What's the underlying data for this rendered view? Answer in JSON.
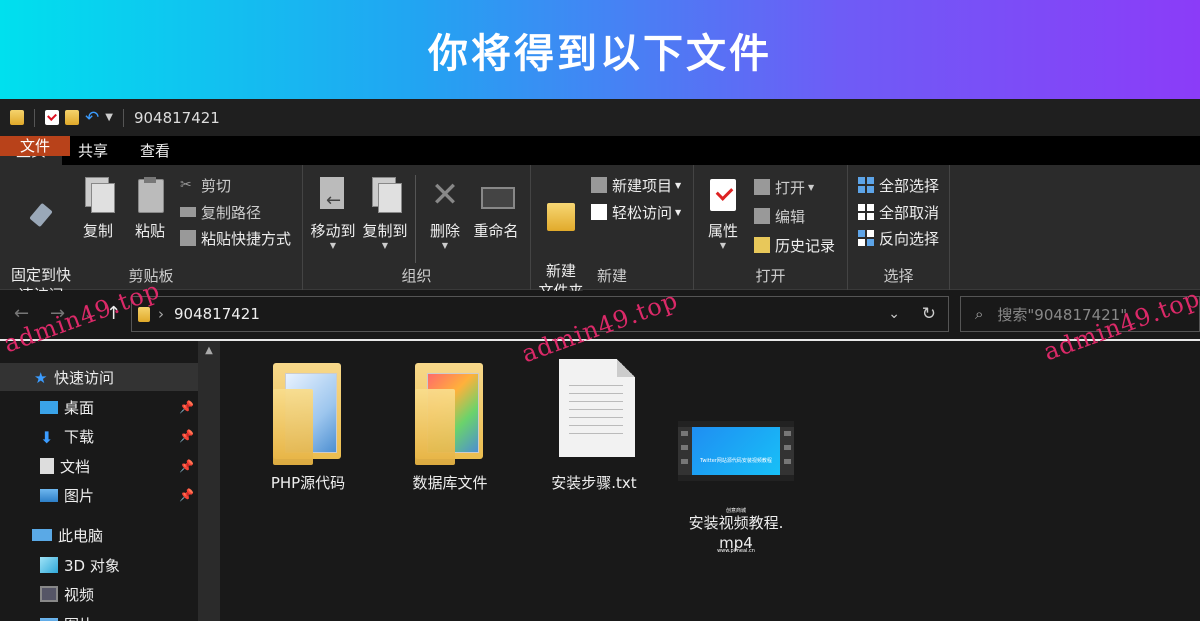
{
  "banner": {
    "title": "你将得到以下文件"
  },
  "titlebar": {
    "path_label": "904817421"
  },
  "tabs": [
    {
      "label": "文件"
    },
    {
      "label": "主页"
    },
    {
      "label": "共享"
    },
    {
      "label": "查看"
    }
  ],
  "ribbon": {
    "clipboard": {
      "pin_label": "固定到快\n速访问",
      "copy_label": "复制",
      "paste_label": "粘贴",
      "cut_label": "剪切",
      "copy_path_label": "复制路径",
      "paste_shortcut_label": "粘贴快捷方式",
      "group_label": "剪贴板"
    },
    "organize": {
      "move_to_label": "移动到",
      "copy_to_label": "复制到",
      "delete_label": "删除",
      "rename_label": "重命名",
      "group_label": "组织"
    },
    "new": {
      "new_folder_label": "新建\n文件夹",
      "new_item_label": "新建项目",
      "easy_access_label": "轻松访问",
      "group_label": "新建"
    },
    "open": {
      "properties_label": "属性",
      "open_label": "打开",
      "edit_label": "编辑",
      "history_label": "历史记录",
      "group_label": "打开"
    },
    "select": {
      "select_all_label": "全部选择",
      "select_none_label": "全部取消",
      "invert_label": "反向选择",
      "group_label": "选择"
    }
  },
  "address": {
    "path": "904817421",
    "search_placeholder": "搜索\"904817421\""
  },
  "nav": {
    "items": [
      {
        "label": "快速访问",
        "pinned": false
      },
      {
        "label": "桌面",
        "pinned": true
      },
      {
        "label": "下载",
        "pinned": true
      },
      {
        "label": "文档",
        "pinned": true
      },
      {
        "label": "图片",
        "pinned": true
      },
      {
        "label": "此电脑",
        "pinned": false
      },
      {
        "label": "3D 对象",
        "pinned": false
      },
      {
        "label": "视频",
        "pinned": false
      },
      {
        "label": "图片",
        "pinned": false
      }
    ]
  },
  "files": [
    {
      "name": "PHP源代码",
      "type": "folder"
    },
    {
      "name": "数据库文件",
      "type": "folder"
    },
    {
      "name": "安装步骤.txt",
      "type": "text"
    },
    {
      "name": "安装视频教程.\nmp4",
      "type": "video"
    }
  ],
  "video_thumb": {
    "title": "Twitter网站源代码安装视频教程",
    "line2": "创意商城",
    "line3": "www.pimeal.cn"
  },
  "watermark": {
    "text": "admin49.top"
  },
  "colors": {
    "file_tab": "#b8421a",
    "accent_blue": "#3b9cff",
    "watermark": "#e62a6d"
  }
}
